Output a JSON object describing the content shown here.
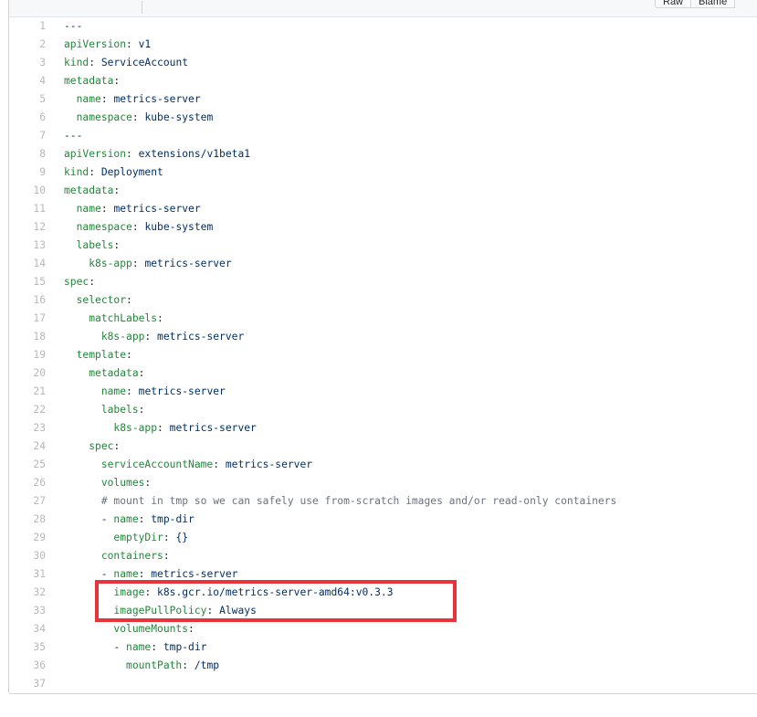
{
  "header": {
    "buttons": [
      "Raw",
      "Blame"
    ]
  },
  "colors": {
    "key": "#22863a",
    "value": "#032f62",
    "comment": "#6a737d",
    "line_number": "#b5b8bc",
    "highlight": "#e8333b"
  },
  "lines": [
    {
      "num": "1",
      "indent": "",
      "key": "",
      "sep": "",
      "value": "---"
    },
    {
      "num": "2",
      "indent": "",
      "key": "apiVersion",
      "sep": ": ",
      "value": "v1"
    },
    {
      "num": "3",
      "indent": "",
      "key": "kind",
      "sep": ": ",
      "value": "ServiceAccount"
    },
    {
      "num": "4",
      "indent": "",
      "key": "metadata",
      "sep": ":",
      "value": ""
    },
    {
      "num": "5",
      "indent": "  ",
      "key": "name",
      "sep": ": ",
      "value": "metrics-server"
    },
    {
      "num": "6",
      "indent": "  ",
      "key": "namespace",
      "sep": ": ",
      "value": "kube-system"
    },
    {
      "num": "7",
      "indent": "",
      "key": "",
      "sep": "",
      "value": "---"
    },
    {
      "num": "8",
      "indent": "",
      "key": "apiVersion",
      "sep": ": ",
      "value": "extensions/v1beta1"
    },
    {
      "num": "9",
      "indent": "",
      "key": "kind",
      "sep": ": ",
      "value": "Deployment"
    },
    {
      "num": "10",
      "indent": "",
      "key": "metadata",
      "sep": ":",
      "value": ""
    },
    {
      "num": "11",
      "indent": "  ",
      "key": "name",
      "sep": ": ",
      "value": "metrics-server"
    },
    {
      "num": "12",
      "indent": "  ",
      "key": "namespace",
      "sep": ": ",
      "value": "kube-system"
    },
    {
      "num": "13",
      "indent": "  ",
      "key": "labels",
      "sep": ":",
      "value": ""
    },
    {
      "num": "14",
      "indent": "    ",
      "key": "k8s-app",
      "sep": ": ",
      "value": "metrics-server"
    },
    {
      "num": "15",
      "indent": "",
      "key": "spec",
      "sep": ":",
      "value": ""
    },
    {
      "num": "16",
      "indent": "  ",
      "key": "selector",
      "sep": ":",
      "value": ""
    },
    {
      "num": "17",
      "indent": "    ",
      "key": "matchLabels",
      "sep": ":",
      "value": ""
    },
    {
      "num": "18",
      "indent": "      ",
      "key": "k8s-app",
      "sep": ": ",
      "value": "metrics-server"
    },
    {
      "num": "19",
      "indent": "  ",
      "key": "template",
      "sep": ":",
      "value": ""
    },
    {
      "num": "20",
      "indent": "    ",
      "key": "metadata",
      "sep": ":",
      "value": ""
    },
    {
      "num": "21",
      "indent": "      ",
      "key": "name",
      "sep": ": ",
      "value": "metrics-server"
    },
    {
      "num": "22",
      "indent": "      ",
      "key": "labels",
      "sep": ":",
      "value": ""
    },
    {
      "num": "23",
      "indent": "        ",
      "key": "k8s-app",
      "sep": ": ",
      "value": "metrics-server"
    },
    {
      "num": "24",
      "indent": "    ",
      "key": "spec",
      "sep": ":",
      "value": ""
    },
    {
      "num": "25",
      "indent": "      ",
      "key": "serviceAccountName",
      "sep": ": ",
      "value": "metrics-server"
    },
    {
      "num": "26",
      "indent": "      ",
      "key": "volumes",
      "sep": ":",
      "value": ""
    },
    {
      "num": "27",
      "indent": "      ",
      "key": "",
      "sep": "",
      "value": "",
      "comment": "# mount in tmp so we can safely use from-scratch images and/or read-only containers"
    },
    {
      "num": "28",
      "indent": "      - ",
      "key": "name",
      "sep": ": ",
      "value": "tmp-dir"
    },
    {
      "num": "29",
      "indent": "        ",
      "key": "emptyDir",
      "sep": ": ",
      "value": "{}"
    },
    {
      "num": "30",
      "indent": "      ",
      "key": "containers",
      "sep": ":",
      "value": ""
    },
    {
      "num": "31",
      "indent": "      - ",
      "key": "name",
      "sep": ": ",
      "value": "metrics-server"
    },
    {
      "num": "32",
      "indent": "        ",
      "key": "image",
      "sep": ": ",
      "value": "k8s.gcr.io/metrics-server-amd64:v0.3.3"
    },
    {
      "num": "33",
      "indent": "        ",
      "key": "imagePullPolicy",
      "sep": ": ",
      "value": "Always"
    },
    {
      "num": "34",
      "indent": "        ",
      "key": "volumeMounts",
      "sep": ":",
      "value": ""
    },
    {
      "num": "35",
      "indent": "        - ",
      "key": "name",
      "sep": ": ",
      "value": "tmp-dir"
    },
    {
      "num": "36",
      "indent": "          ",
      "key": "mountPath",
      "sep": ": ",
      "value": "/tmp"
    },
    {
      "num": "37",
      "indent": "",
      "key": "",
      "sep": "",
      "value": ""
    }
  ]
}
